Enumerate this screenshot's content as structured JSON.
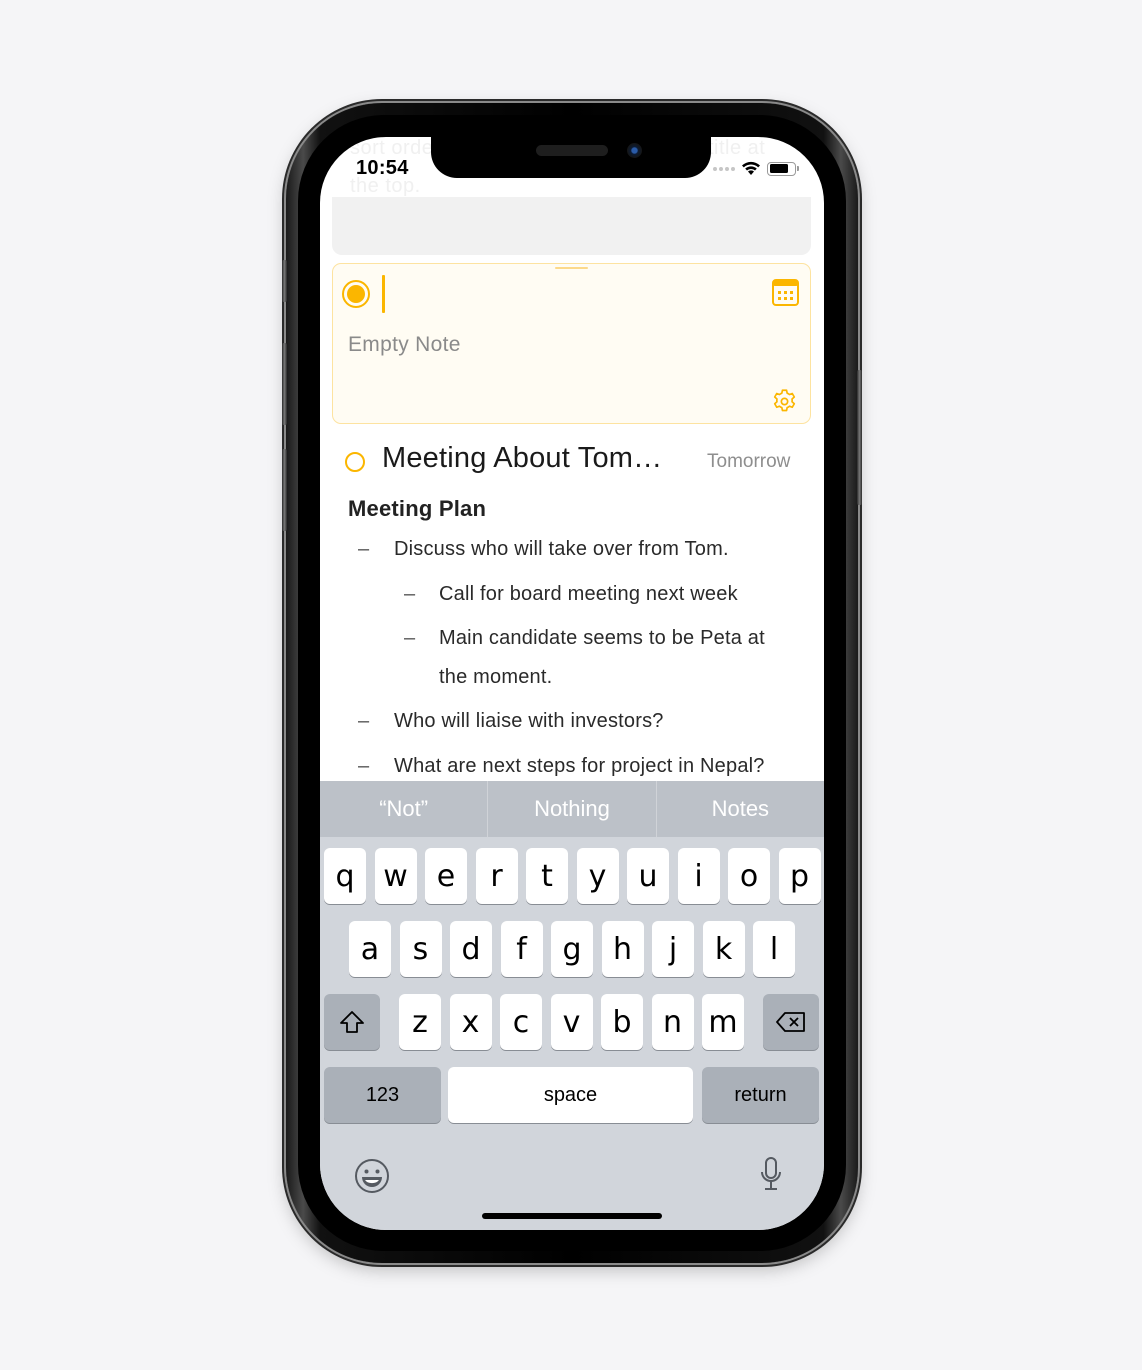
{
  "status_bar": {
    "time": "10:54",
    "signal": "no-service-dots",
    "wifi_icon": "wifi-icon",
    "battery_level": 0.75
  },
  "background_text": {
    "line1_left": "sort order",
    "line1_right": "title at",
    "line2": "the top."
  },
  "new_note": {
    "title_value": "",
    "placeholder": "Empty Note",
    "selected": true,
    "icons": {
      "calendar": "calendar-icon",
      "settings": "gear-icon"
    }
  },
  "note": {
    "title": "Meeting About Tom…",
    "date": "Tomorrow",
    "completed": false,
    "heading": "Meeting Plan",
    "bullets": [
      {
        "level": 1,
        "dash": "–",
        "text": "Discuss who will take over from Tom."
      },
      {
        "level": 2,
        "dash": "–",
        "text": "Call for board meeting next week"
      },
      {
        "level": 2,
        "dash": "–",
        "text": "Main candidate seems to be Peta at"
      },
      {
        "level": 2,
        "dash": "",
        "text": "the moment."
      },
      {
        "level": 1,
        "dash": "–",
        "text": "Who will liaise with investors?"
      },
      {
        "level": 1,
        "dash": "–",
        "text": "What are next steps for project in Nepal?"
      }
    ]
  },
  "keyboard": {
    "suggestions": [
      "“Not”",
      "Nothing",
      "Notes"
    ],
    "row1": [
      "q",
      "w",
      "e",
      "r",
      "t",
      "y",
      "u",
      "i",
      "o",
      "p"
    ],
    "row2": [
      "a",
      "s",
      "d",
      "f",
      "g",
      "h",
      "j",
      "k",
      "l"
    ],
    "row3": [
      "z",
      "x",
      "c",
      "v",
      "b",
      "n",
      "m"
    ],
    "numbers_label": "123",
    "space_label": "space",
    "return_label": "return",
    "shift_icon": "shift-icon",
    "delete_icon": "delete-icon",
    "emoji_icon": "emoji-icon",
    "mic_icon": "microphone-icon"
  },
  "colors": {
    "accent": "#fbb600",
    "card_bg": "#fffcf3",
    "card_border": "#fde3a0",
    "keyboard_bg": "#d1d5db",
    "suggest_bg": "#bcc1c8"
  }
}
